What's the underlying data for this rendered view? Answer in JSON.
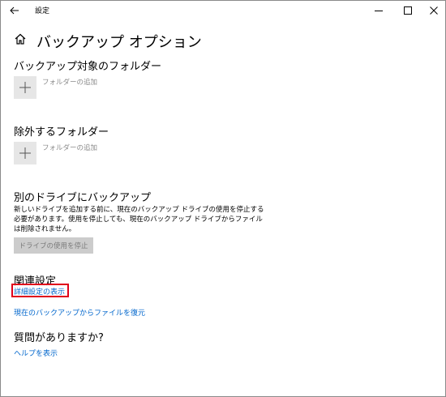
{
  "window": {
    "title": "設定"
  },
  "page": {
    "title": "バックアップ オプション"
  },
  "sections": {
    "backup_folders": {
      "title": "バックアップ対象のフォルダー",
      "add_label": "フォルダーの追加"
    },
    "exclude_folders": {
      "title": "除外するフォルダー",
      "add_label": "フォルダーの追加"
    },
    "other_drive": {
      "title": "別のドライブにバックアップ",
      "description": "新しいドライブを追加する前に、現在のバックアップ ドライブの使用を停止する必要があります。使用を停止しても、現在のバックアップ ドライブからファイルは削除されません。",
      "stop_button": "ドライブの使用を停止"
    },
    "related": {
      "title": "関連設定",
      "advanced_link": "詳細設定の表示",
      "restore_link": "現在のバックアップからファイルを復元"
    },
    "question": {
      "title": "質問がありますか?",
      "help_link": "ヘルプを表示"
    }
  },
  "colors": {
    "link": "#0066cc",
    "highlight": "#e0001b",
    "tile": "#e6e6e6",
    "disabled_button": "#cccccc"
  },
  "icons": {
    "back": "back-arrow-icon",
    "home": "home-icon",
    "add": "plus-icon",
    "minimize": "minimize-icon",
    "maximize": "maximize-icon",
    "close": "close-icon"
  }
}
